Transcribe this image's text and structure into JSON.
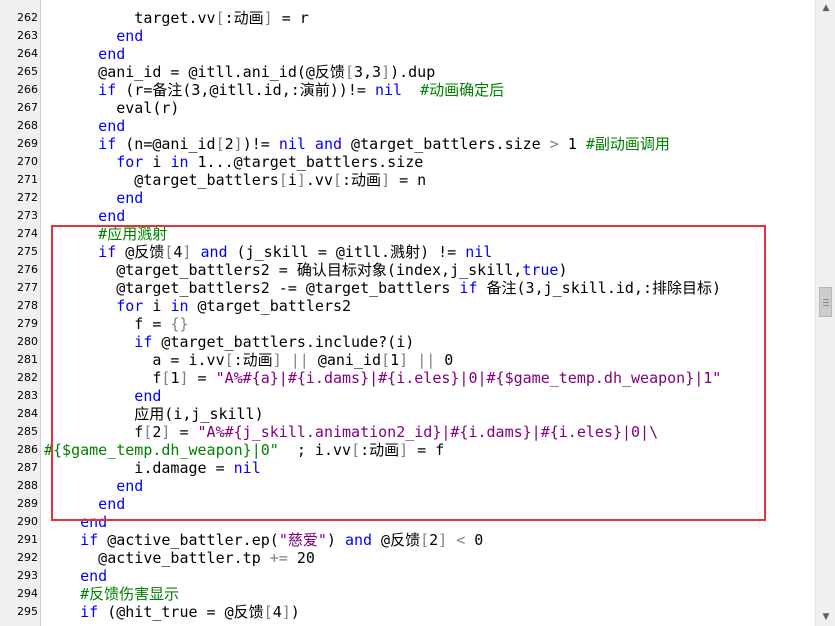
{
  "editor": {
    "lines": [
      {
        "num": "262",
        "tokens": [
          {
            "t": "          target.vv",
            "c": "n"
          },
          {
            "t": "[",
            "c": "o"
          },
          {
            "t": ":动画",
            "c": "n"
          },
          {
            "t": "]",
            "c": "o"
          },
          {
            "t": " = r",
            "c": "n"
          }
        ]
      },
      {
        "num": "263",
        "tokens": [
          {
            "t": "        end",
            "c": "k"
          }
        ]
      },
      {
        "num": "264",
        "tokens": [
          {
            "t": "      end",
            "c": "k"
          }
        ]
      },
      {
        "num": "265",
        "tokens": [
          {
            "t": "      @ani_id = @itll.ani_id(@反馈",
            "c": "n"
          },
          {
            "t": "[",
            "c": "o"
          },
          {
            "t": "3,3",
            "c": "n"
          },
          {
            "t": "]",
            "c": "o"
          },
          {
            "t": ").dup",
            "c": "n"
          }
        ]
      },
      {
        "num": "266",
        "tokens": [
          {
            "t": "      if",
            "c": "k"
          },
          {
            "t": " (r=备注(3,@itll.id,:演前))!= ",
            "c": "n"
          },
          {
            "t": "nil",
            "c": "k"
          },
          {
            "t": "  #动画确定后",
            "c": "c"
          }
        ]
      },
      {
        "num": "267",
        "tokens": [
          {
            "t": "        eval(r)",
            "c": "n"
          }
        ]
      },
      {
        "num": "268",
        "tokens": [
          {
            "t": "      end",
            "c": "k"
          }
        ]
      },
      {
        "num": "269",
        "tokens": [
          {
            "t": "      if",
            "c": "k"
          },
          {
            "t": " (n=@ani_id",
            "c": "n"
          },
          {
            "t": "[",
            "c": "o"
          },
          {
            "t": "2",
            "c": "n"
          },
          {
            "t": "]",
            "c": "o"
          },
          {
            "t": ")!= ",
            "c": "n"
          },
          {
            "t": "nil and",
            "c": "k"
          },
          {
            "t": " @target_battlers.size ",
            "c": "n"
          },
          {
            "t": ">",
            "c": "o"
          },
          {
            "t": " 1 ",
            "c": "n"
          },
          {
            "t": "#副动画调用",
            "c": "c"
          }
        ]
      },
      {
        "num": "270",
        "tokens": [
          {
            "t": "        for",
            "c": "k"
          },
          {
            "t": " i ",
            "c": "n"
          },
          {
            "t": "in",
            "c": "k"
          },
          {
            "t": " 1...@target_battlers.size",
            "c": "n"
          }
        ]
      },
      {
        "num": "271",
        "tokens": [
          {
            "t": "          @target_battlers",
            "c": "n"
          },
          {
            "t": "[",
            "c": "o"
          },
          {
            "t": "i",
            "c": "n"
          },
          {
            "t": "]",
            "c": "o"
          },
          {
            "t": ".vv",
            "c": "n"
          },
          {
            "t": "[",
            "c": "o"
          },
          {
            "t": ":动画",
            "c": "n"
          },
          {
            "t": "]",
            "c": "o"
          },
          {
            "t": " = n",
            "c": "n"
          }
        ]
      },
      {
        "num": "272",
        "tokens": [
          {
            "t": "        end",
            "c": "k"
          }
        ]
      },
      {
        "num": "273",
        "tokens": [
          {
            "t": "      end",
            "c": "k"
          }
        ]
      },
      {
        "num": "274",
        "tokens": [
          {
            "t": "      #应用溅射",
            "c": "c"
          }
        ]
      },
      {
        "num": "275",
        "tokens": [
          {
            "t": "      if",
            "c": "k"
          },
          {
            "t": " @反馈",
            "c": "n"
          },
          {
            "t": "[",
            "c": "o"
          },
          {
            "t": "4",
            "c": "n"
          },
          {
            "t": "]",
            "c": "o"
          },
          {
            "t": " ",
            "c": "n"
          },
          {
            "t": "and",
            "c": "k"
          },
          {
            "t": " (j_skill = @itll.溅射) != ",
            "c": "n"
          },
          {
            "t": "nil",
            "c": "k"
          }
        ]
      },
      {
        "num": "276",
        "tokens": [
          {
            "t": "        @target_battlers2 = 确认目标对象(index,j_skill,",
            "c": "n"
          },
          {
            "t": "true",
            "c": "k"
          },
          {
            "t": ")",
            "c": "n"
          }
        ]
      },
      {
        "num": "277",
        "tokens": [
          {
            "t": "        @target_battlers2 -= @target_battlers ",
            "c": "n"
          },
          {
            "t": "if",
            "c": "k"
          },
          {
            "t": " 备注(3,j_skill.id,:排除目标)",
            "c": "n"
          }
        ]
      },
      {
        "num": "278",
        "tokens": [
          {
            "t": "        for",
            "c": "k"
          },
          {
            "t": " i ",
            "c": "n"
          },
          {
            "t": "in",
            "c": "k"
          },
          {
            "t": " @target_battlers2",
            "c": "n"
          }
        ]
      },
      {
        "num": "279",
        "tokens": [
          {
            "t": "          f = ",
            "c": "n"
          },
          {
            "t": "{}",
            "c": "o"
          }
        ]
      },
      {
        "num": "280",
        "tokens": [
          {
            "t": "          if",
            "c": "k"
          },
          {
            "t": " @target_battlers.include?(i)",
            "c": "n"
          }
        ]
      },
      {
        "num": "281",
        "tokens": [
          {
            "t": "            a = i.vv",
            "c": "n"
          },
          {
            "t": "[",
            "c": "o"
          },
          {
            "t": ":动画",
            "c": "n"
          },
          {
            "t": "]",
            "c": "o"
          },
          {
            "t": " ",
            "c": "n"
          },
          {
            "t": "||",
            "c": "o"
          },
          {
            "t": " @ani_id",
            "c": "n"
          },
          {
            "t": "[",
            "c": "o"
          },
          {
            "t": "1",
            "c": "n"
          },
          {
            "t": "]",
            "c": "o"
          },
          {
            "t": " ",
            "c": "n"
          },
          {
            "t": "||",
            "c": "o"
          },
          {
            "t": " 0",
            "c": "n"
          }
        ]
      },
      {
        "num": "282",
        "tokens": [
          {
            "t": "            f",
            "c": "n"
          },
          {
            "t": "[",
            "c": "o"
          },
          {
            "t": "1",
            "c": "n"
          },
          {
            "t": "]",
            "c": "o"
          },
          {
            "t": " = ",
            "c": "n"
          },
          {
            "t": "\"A%#{a}|#{i.dams}|#{i.eles}|0|#{$game_temp.dh_weapon}|1\"",
            "c": "s"
          }
        ]
      },
      {
        "num": "283",
        "tokens": [
          {
            "t": "          end",
            "c": "k"
          }
        ]
      },
      {
        "num": "284",
        "tokens": [
          {
            "t": "          应用(i,j_skill)",
            "c": "n"
          }
        ]
      },
      {
        "num": "285",
        "tokens": [
          {
            "t": "          f",
            "c": "n"
          },
          {
            "t": "[",
            "c": "o"
          },
          {
            "t": "2",
            "c": "n"
          },
          {
            "t": "]",
            "c": "o"
          },
          {
            "t": " = ",
            "c": "n"
          },
          {
            "t": "\"A%#{j_skill.animation2_id}|#{i.dams}|#{i.eles}|0|\\",
            "c": "s"
          }
        ]
      },
      {
        "num": "286",
        "tokens": [
          {
            "t": "#{$game_temp.dh_weapon}|0\"",
            "c": "g"
          },
          {
            "t": "  ; i.vv",
            "c": "n"
          },
          {
            "t": "[",
            "c": "o"
          },
          {
            "t": ":动画",
            "c": "n"
          },
          {
            "t": "]",
            "c": "o"
          },
          {
            "t": " = f",
            "c": "n"
          }
        ]
      },
      {
        "num": "287",
        "tokens": [
          {
            "t": "          i.damage = ",
            "c": "n"
          },
          {
            "t": "nil",
            "c": "k"
          }
        ]
      },
      {
        "num": "288",
        "tokens": [
          {
            "t": "        end",
            "c": "k"
          }
        ]
      },
      {
        "num": "289",
        "tokens": [
          {
            "t": "      end",
            "c": "k"
          }
        ]
      },
      {
        "num": "290",
        "tokens": [
          {
            "t": "    end",
            "c": "k"
          }
        ]
      },
      {
        "num": "291",
        "tokens": [
          {
            "t": "    if",
            "c": "k"
          },
          {
            "t": " @active_battler.ep(",
            "c": "n"
          },
          {
            "t": "\"慈爱\"",
            "c": "s"
          },
          {
            "t": ") ",
            "c": "n"
          },
          {
            "t": "and",
            "c": "k"
          },
          {
            "t": " @反馈",
            "c": "n"
          },
          {
            "t": "[",
            "c": "o"
          },
          {
            "t": "2",
            "c": "n"
          },
          {
            "t": "]",
            "c": "o"
          },
          {
            "t": " ",
            "c": "n"
          },
          {
            "t": "<",
            "c": "o"
          },
          {
            "t": " 0",
            "c": "n"
          }
        ]
      },
      {
        "num": "292",
        "tokens": [
          {
            "t": "      @active_battler.tp ",
            "c": "n"
          },
          {
            "t": "+=",
            "c": "o"
          },
          {
            "t": " 20",
            "c": "n"
          }
        ]
      },
      {
        "num": "293",
        "tokens": [
          {
            "t": "    end",
            "c": "k"
          }
        ]
      },
      {
        "num": "294",
        "tokens": [
          {
            "t": "    #反馈伤害显示",
            "c": "c"
          }
        ]
      },
      {
        "num": "295",
        "tokens": [
          {
            "t": "    if",
            "c": "k"
          },
          {
            "t": " (@hit_true = @反馈",
            "c": "n"
          },
          {
            "t": "[",
            "c": "o"
          },
          {
            "t": "4",
            "c": "n"
          },
          {
            "t": "]",
            "c": "o"
          },
          {
            "t": ")",
            "c": "n"
          }
        ]
      }
    ]
  },
  "scrollbar": {
    "up_arrow": "▲",
    "down_arrow": "▼"
  },
  "colors": {
    "keyword": "#0000ff",
    "string": "#800080",
    "comment": "#008000",
    "highlight_box": "#e53135"
  }
}
